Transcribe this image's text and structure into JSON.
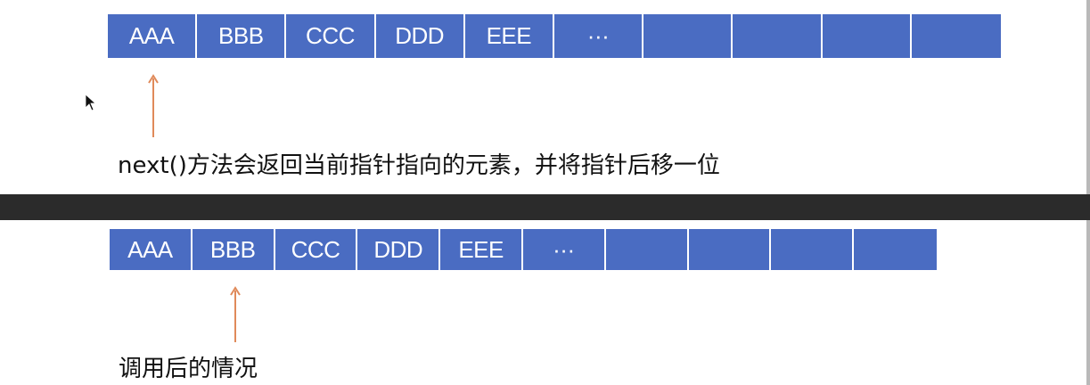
{
  "top": {
    "cells": [
      "AAA",
      "BBB",
      "CCC",
      "DDD",
      "EEE",
      "···",
      "",
      "",
      "",
      ""
    ],
    "pointer_index": 0,
    "caption": "next()方法会返回当前指针指向的元素，并将指针后移一位"
  },
  "bottom": {
    "cells": [
      "AAA",
      "BBB",
      "CCC",
      "DDD",
      "EEE",
      "···",
      "",
      "",
      "",
      ""
    ],
    "pointer_index": 1,
    "caption": "调用后的情况"
  },
  "colors": {
    "cell_fill": "#4a6cc2",
    "cell_text": "#ffffff",
    "arrow": "#e08a5a",
    "background": "#2b2b2b"
  },
  "icons": [
    "mouse-cursor-icon",
    "up-arrow-icon"
  ]
}
